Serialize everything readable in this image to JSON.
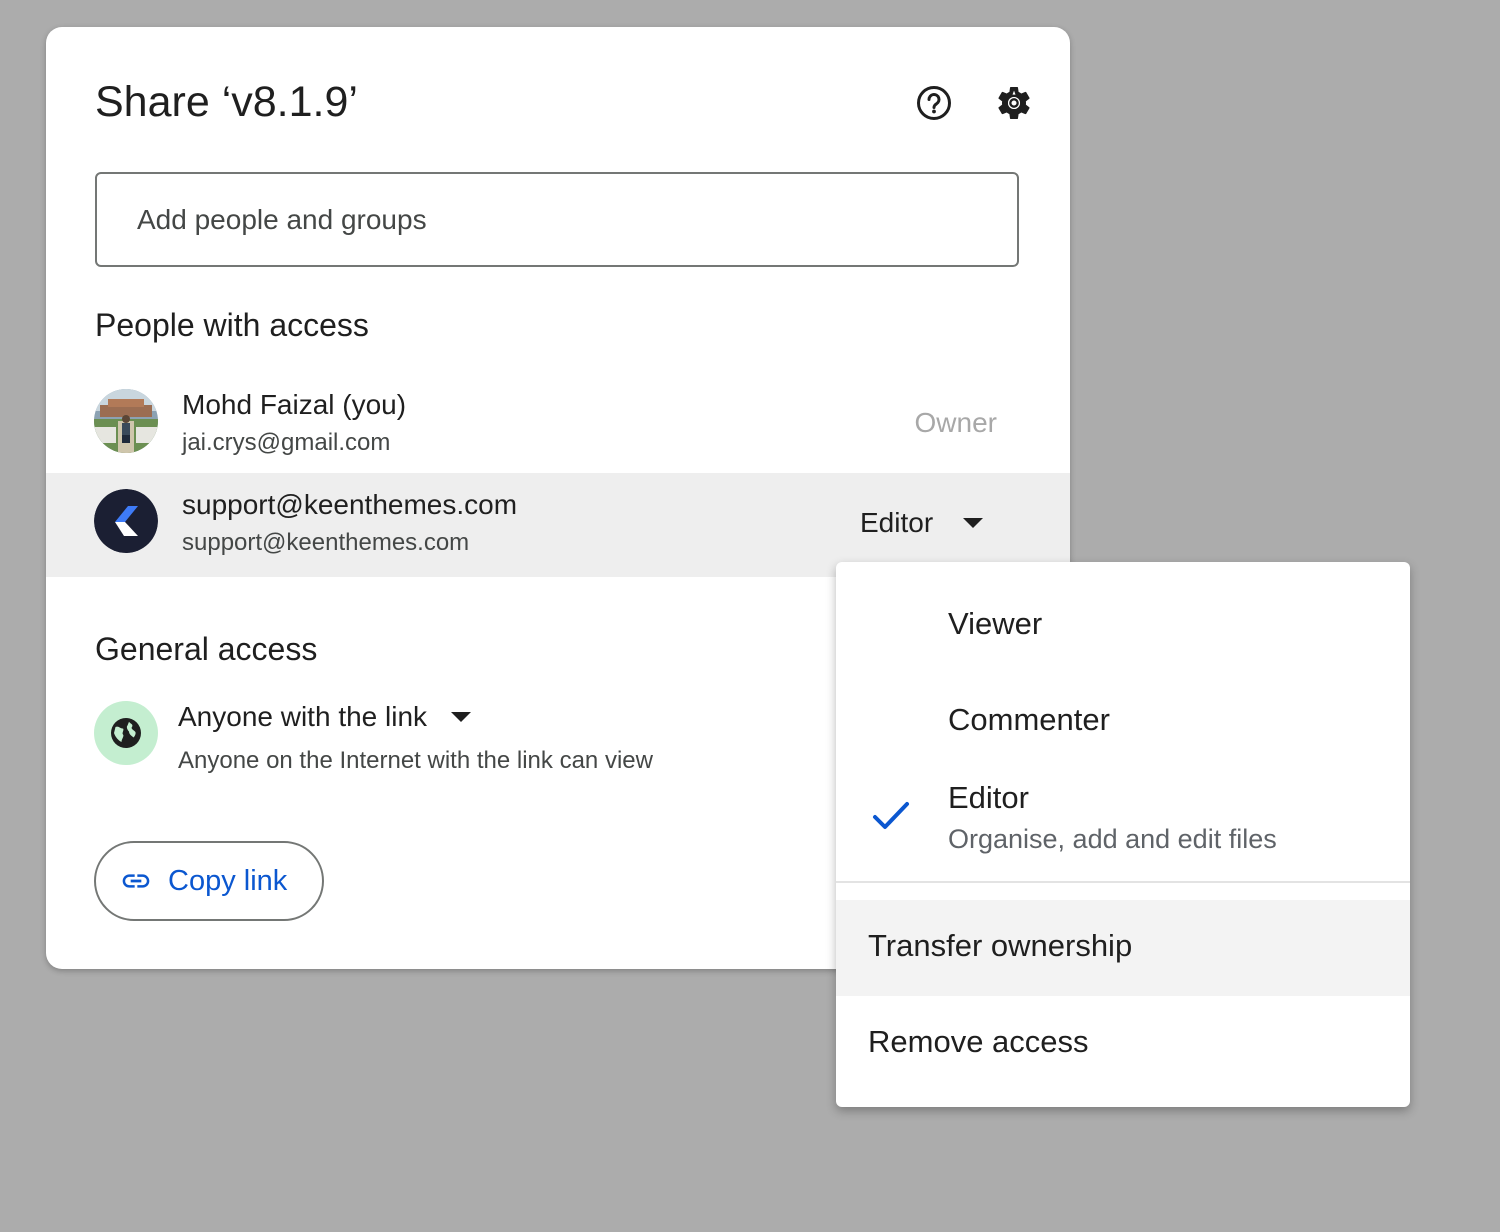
{
  "dialog": {
    "title": "Share ‘v8.1.9’",
    "help_icon": "help-circle-icon",
    "settings_icon": "gear-icon"
  },
  "search": {
    "placeholder": "Add people and groups"
  },
  "people_section": {
    "title": "People with access",
    "people": [
      {
        "name": "Mohd Faizal (you)",
        "email": "jai.crys@gmail.com",
        "role": "Owner",
        "avatar": "user-photo-avatar"
      },
      {
        "name": "support@keenthemes.com",
        "email": "support@keenthemes.com",
        "role": "Editor",
        "avatar": "keenthemes-logo-avatar"
      }
    ]
  },
  "general_access": {
    "title": "General access",
    "icon": "globe-icon",
    "selection": "Anyone with the link",
    "description": "Anyone on the Internet with the link can view"
  },
  "copy_link": {
    "label": "Copy link",
    "icon": "link-icon",
    "color": "#0b57d0"
  },
  "role_menu": {
    "items": [
      {
        "label": "Viewer",
        "selected": false
      },
      {
        "label": "Commenter",
        "selected": false
      },
      {
        "label": "Editor",
        "description": "Organise, add and edit files",
        "selected": true
      }
    ],
    "actions": [
      {
        "label": "Transfer ownership"
      },
      {
        "label": "Remove access"
      }
    ],
    "check_color": "#0b57d0"
  }
}
